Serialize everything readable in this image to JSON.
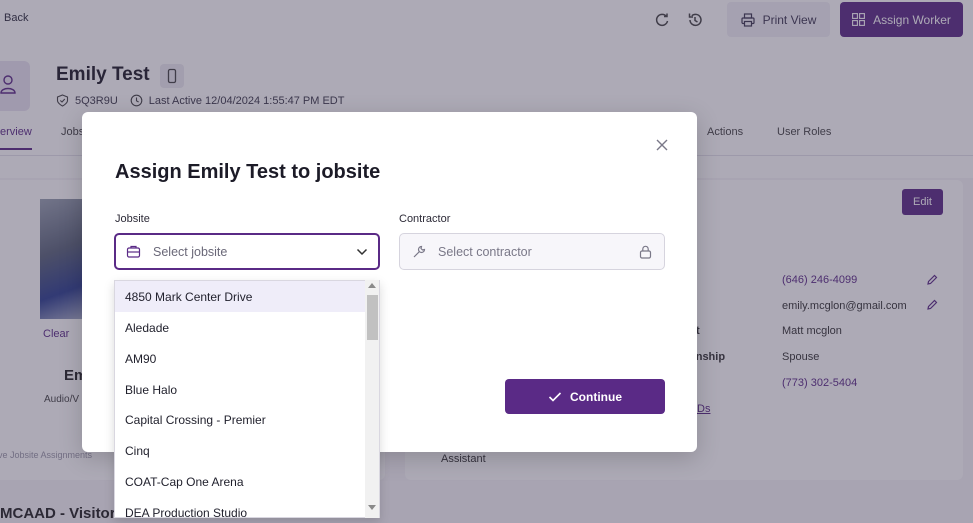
{
  "topbar": {
    "back_label": "Back",
    "print_label": "Print View",
    "assign_label": "Assign Worker"
  },
  "worker": {
    "name": "Emily Test",
    "code": "5Q3R9U",
    "last_active": "Last Active 12/04/2024 1:55:47 PM EDT"
  },
  "tabs": [
    "erview",
    "Jobs",
    "Actions",
    "User Roles"
  ],
  "left_card": {
    "clear_label": "Clear",
    "name_partial": "Em",
    "role_partial": "Audio/V",
    "assignments_partial": "ve Jobsite Assignments",
    "section_partial": "MCAAD - Visitors Center"
  },
  "right_card": {
    "edit_label": "Edit",
    "phone": "(646) 246-4099",
    "email": "emily.mcglon@gmail.com",
    "contact_label_partial": "t",
    "contact_name": "Matt mcglon",
    "relationship_label_partial": "onship",
    "relationship": "Spouse",
    "contact_phone": "(773) 302-5404",
    "link_partial": "Ds",
    "assistant_label": "Assistant"
  },
  "modal": {
    "title": "Assign Emily Test to jobsite",
    "jobsite_label": "Jobsite",
    "jobsite_placeholder": "Select jobsite",
    "contractor_label": "Contractor",
    "contractor_placeholder": "Select contractor",
    "continue_label": "Continue"
  },
  "dropdown": {
    "options": [
      "4850 Mark Center Drive",
      "Aledade",
      "AM90",
      "Blue Halo",
      "Capital Crossing - Premier",
      "Cinq",
      "COAT-Cap One Arena",
      "DEA Production Studio"
    ],
    "highlighted_index": 0
  },
  "colors": {
    "primary": "#5a2a86",
    "highlight": "#efedf9"
  }
}
